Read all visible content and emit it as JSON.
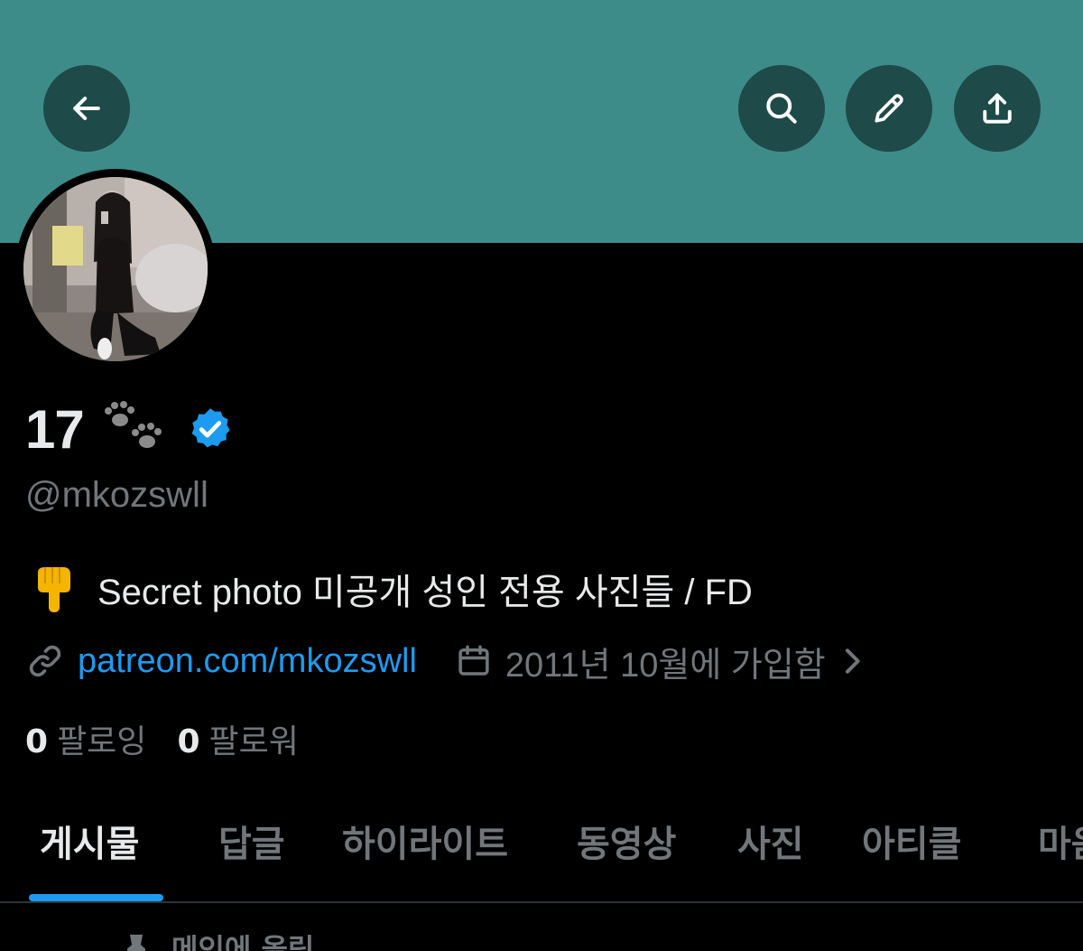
{
  "header": {
    "back_icon": "arrow-left-icon",
    "search_icon": "search-icon",
    "edit_icon": "pencil-icon",
    "share_icon": "share-upload-icon",
    "banner_color": "#3e8c8a",
    "button_color": "#1e4a49"
  },
  "profile": {
    "display_name": "17",
    "name_emoji": "paw-prints-icon",
    "verified_icon": "verified-badge-icon",
    "handle": "@mkozswll",
    "bio_emoji": "pointing-down-hand-icon",
    "bio": "Secret photo 미공개 성인 전용 사진들 / FD",
    "link_icon": "link-icon",
    "link": "patreon.com/mkozswll",
    "calendar_icon": "calendar-icon",
    "joined": "2011년 10월에 가입함",
    "following_count": "0",
    "following_label": "팔로잉",
    "followers_count": "0",
    "followers_label": "팔로워"
  },
  "tabs": [
    {
      "label": "게시물",
      "active": true
    },
    {
      "label": "답글"
    },
    {
      "label": "하이라이트"
    },
    {
      "label": "동영상"
    },
    {
      "label": "사진"
    },
    {
      "label": "아티클"
    },
    {
      "label": "마음"
    }
  ],
  "pinned": {
    "icon": "pin-icon",
    "label": "메인에 올림"
  },
  "colors": {
    "accent": "#1d9bf0",
    "muted_text": "#71767b",
    "primary_text": "#e7e9ea"
  }
}
